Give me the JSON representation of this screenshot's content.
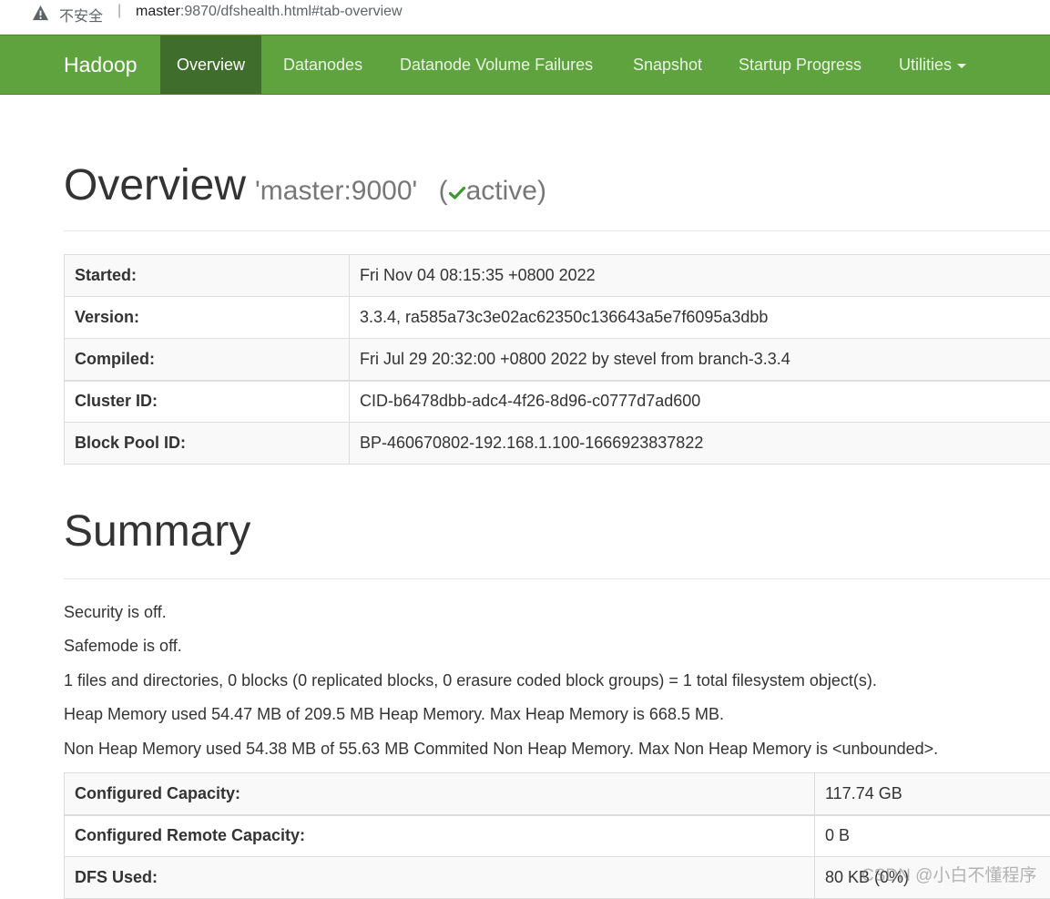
{
  "browser": {
    "security_label": "不安全",
    "separator": "|",
    "url_host": "master",
    "url_rest": ":9870/dfshealth.html#tab-overview"
  },
  "nav": {
    "brand": "Hadoop",
    "items": [
      {
        "label": "Overview",
        "active": true
      },
      {
        "label": "Datanodes"
      },
      {
        "label": "Datanode Volume Failures"
      },
      {
        "label": "Snapshot"
      },
      {
        "label": "Startup Progress"
      },
      {
        "label": "Utilities"
      }
    ],
    "accent_color": "#5fa33e",
    "active_color": "#3f6d2c"
  },
  "overview": {
    "title": "Overview",
    "host": "'master:9000'",
    "state_open": "(",
    "state": "active)",
    "check_color": "#3c9a2f",
    "rows": [
      {
        "key": "Started:",
        "value": "Fri Nov 04 08:15:35 +0800 2022"
      },
      {
        "key": "Version:",
        "value": "3.3.4, ra585a73c3e02ac62350c136643a5e7f6095a3dbb"
      },
      {
        "key": "Compiled:",
        "value": "Fri Jul 29 20:32:00 +0800 2022 by stevel from branch-3.3.4"
      },
      {
        "key": "Cluster ID:",
        "value": "CID-b6478dbb-adc4-4f26-8d96-c0777d7ad600"
      },
      {
        "key": "Block Pool ID:",
        "value": "BP-460670802-192.168.1.100-1666923837822"
      }
    ]
  },
  "summary": {
    "title": "Summary",
    "lines": [
      "Security is off.",
      "Safemode is off.",
      "1 files and directories, 0 blocks (0 replicated blocks, 0 erasure coded block groups) = 1 total filesystem object(s).",
      "Heap Memory used 54.47 MB of 209.5 MB Heap Memory. Max Heap Memory is 668.5 MB.",
      "Non Heap Memory used 54.38 MB of 55.63 MB Commited Non Heap Memory. Max Non Heap Memory is <unbounded>."
    ],
    "rows": [
      {
        "key": "Configured Capacity:",
        "value": "117.74 GB"
      },
      {
        "key": "Configured Remote Capacity:",
        "value": "0 B"
      },
      {
        "key": "DFS Used:",
        "value": "80 KB (0%)"
      }
    ]
  },
  "watermark": "CSDN @小白不懂程序"
}
